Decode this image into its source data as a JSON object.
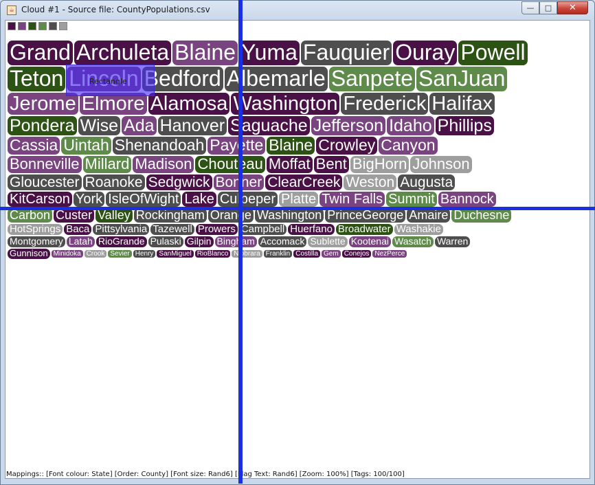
{
  "window": {
    "title": "Cloud #1 - Source file: CountyPopulations.csv",
    "app_icon": "java-cup-icon",
    "controls": {
      "minimize": "—",
      "maximize": "□",
      "close": "✕"
    }
  },
  "palette": [
    "#4a1147",
    "#7a4480",
    "#2d5314",
    "#5e8a4a",
    "#4e4e4e",
    "#9e9e9e"
  ],
  "selection": {
    "label": "Rectangle"
  },
  "cloud": {
    "rows": [
      {
        "size": 32,
        "tags": [
          {
            "text": "Grand",
            "color": "#4a1147"
          },
          {
            "text": "Archuleta",
            "color": "#4a1147"
          },
          {
            "text": "Blaine",
            "color": "#7a4480"
          },
          {
            "text": "Yuma",
            "color": "#4a1147"
          },
          {
            "text": "Fauquier",
            "color": "#4e4e4e"
          },
          {
            "text": "Ouray",
            "color": "#4a1147"
          },
          {
            "text": "Powell",
            "color": "#2d5314"
          }
        ]
      },
      {
        "size": 32,
        "tags": [
          {
            "text": "Teton",
            "color": "#2d5314"
          },
          {
            "text": "Lincoln",
            "color": "#7a4480"
          },
          {
            "text": "Bedford",
            "color": "#4e4e4e"
          },
          {
            "text": "Albemarle",
            "color": "#4e4e4e"
          },
          {
            "text": "Sanpete",
            "color": "#5e8a4a"
          },
          {
            "text": "SanJuan",
            "color": "#5e8a4a"
          }
        ]
      },
      {
        "size": 29,
        "tags": [
          {
            "text": "Jerome",
            "color": "#7a4480"
          },
          {
            "text": "Elmore",
            "color": "#7a4480"
          },
          {
            "text": "Alamosa",
            "color": "#4a1147"
          },
          {
            "text": "Washington",
            "color": "#4a1147"
          },
          {
            "text": "Frederick",
            "color": "#4e4e4e"
          },
          {
            "text": "Halifax",
            "color": "#4e4e4e"
          }
        ]
      },
      {
        "size": 25,
        "tags": [
          {
            "text": "Pondera",
            "color": "#2d5314"
          },
          {
            "text": "Wise",
            "color": "#4e4e4e"
          },
          {
            "text": "Ada",
            "color": "#7a4480"
          },
          {
            "text": "Hanover",
            "color": "#4e4e4e"
          },
          {
            "text": "Saguache",
            "color": "#4a1147"
          },
          {
            "text": "Jefferson",
            "color": "#7a4480"
          },
          {
            "text": "Idaho",
            "color": "#7a4480"
          },
          {
            "text": "Phillips",
            "color": "#4a1147"
          }
        ]
      },
      {
        "size": 23,
        "tags": [
          {
            "text": "Cassia",
            "color": "#7a4480"
          },
          {
            "text": "Uintah",
            "color": "#5e8a4a"
          },
          {
            "text": "Shenandoah",
            "color": "#4e4e4e"
          },
          {
            "text": "Payette",
            "color": "#7a4480"
          },
          {
            "text": "Blaine",
            "color": "#2d5314"
          },
          {
            "text": "Crowley",
            "color": "#4a1147"
          },
          {
            "text": "Canyon",
            "color": "#7a4480"
          }
        ]
      },
      {
        "size": 22,
        "tags": [
          {
            "text": "Bonneville",
            "color": "#7a4480"
          },
          {
            "text": "Millard",
            "color": "#5e8a4a"
          },
          {
            "text": "Madison",
            "color": "#7a4480"
          },
          {
            "text": "Chouteau",
            "color": "#2d5314"
          },
          {
            "text": "Moffat",
            "color": "#4a1147"
          },
          {
            "text": "Bent",
            "color": "#4a1147"
          },
          {
            "text": "BigHorn",
            "color": "#9e9e9e"
          },
          {
            "text": "Johnson",
            "color": "#9e9e9e"
          }
        ]
      },
      {
        "size": 21,
        "tags": [
          {
            "text": "Gloucester",
            "color": "#4e4e4e"
          },
          {
            "text": "Roanoke",
            "color": "#4e4e4e"
          },
          {
            "text": "Sedgwick",
            "color": "#4a1147"
          },
          {
            "text": "Bonner",
            "color": "#7a4480"
          },
          {
            "text": "ClearCreek",
            "color": "#4a1147"
          },
          {
            "text": "Weston",
            "color": "#9e9e9e"
          },
          {
            "text": "Augusta",
            "color": "#4e4e4e"
          }
        ]
      },
      {
        "size": 20,
        "tags": [
          {
            "text": "KitCarson",
            "color": "#4a1147"
          },
          {
            "text": "York",
            "color": "#4e4e4e"
          },
          {
            "text": "IsleOfWight",
            "color": "#4e4e4e"
          },
          {
            "text": "Lake",
            "color": "#4a1147"
          },
          {
            "text": "Culpeper",
            "color": "#4e4e4e"
          },
          {
            "text": "Platte",
            "color": "#9e9e9e"
          },
          {
            "text": "Twin Falls",
            "color": "#7a4480"
          },
          {
            "text": "Summit",
            "color": "#5e8a4a"
          },
          {
            "text": "Bannock",
            "color": "#7a4480"
          }
        ]
      },
      {
        "size": 18,
        "tags": [
          {
            "text": "Carbon",
            "color": "#5e8a4a"
          },
          {
            "text": "Custer",
            "color": "#4a1147"
          },
          {
            "text": "Valley",
            "color": "#2d5314"
          },
          {
            "text": "Rockingham",
            "color": "#4e4e4e"
          },
          {
            "text": "Orange",
            "color": "#4e4e4e"
          },
          {
            "text": "Washington",
            "color": "#4e4e4e"
          },
          {
            "text": "PrinceGeorge",
            "color": "#4e4e4e"
          },
          {
            "text": "Amaire",
            "color": "#4e4e4e"
          },
          {
            "text": "Duchesne",
            "color": "#5e8a4a"
          }
        ]
      },
      {
        "size": 15,
        "tags": [
          {
            "text": "HotSprings",
            "color": "#9e9e9e"
          },
          {
            "text": "Baca",
            "color": "#4a1147"
          },
          {
            "text": "Pittsylvania",
            "color": "#4e4e4e"
          },
          {
            "text": "Tazewell",
            "color": "#4e4e4e"
          },
          {
            "text": "Prowers",
            "color": "#4a1147"
          },
          {
            "text": "Campbell",
            "color": "#4e4e4e"
          },
          {
            "text": "Huerfano",
            "color": "#4a1147"
          },
          {
            "text": "Broadwater",
            "color": "#2d5314"
          },
          {
            "text": "Washakie",
            "color": "#9e9e9e"
          }
        ]
      },
      {
        "size": 14,
        "tags": [
          {
            "text": "Montgomery",
            "color": "#4e4e4e"
          },
          {
            "text": "Latah",
            "color": "#7a4480"
          },
          {
            "text": "RioGrande",
            "color": "#4a1147"
          },
          {
            "text": "Pulaski",
            "color": "#4e4e4e"
          },
          {
            "text": "Gilpin",
            "color": "#4a1147"
          },
          {
            "text": "Bingham",
            "color": "#7a4480"
          },
          {
            "text": "Accomack",
            "color": "#4e4e4e"
          },
          {
            "text": "Sublette",
            "color": "#9e9e9e"
          },
          {
            "text": "Kootenai",
            "color": "#7a4480"
          },
          {
            "text": "Wasatch",
            "color": "#5e8a4a"
          },
          {
            "text": "Warren",
            "color": "#4e4e4e"
          }
        ]
      },
      {
        "size": 13,
        "tags": [
          {
            "text": "Gunnison",
            "color": "#4a1147"
          }
        ]
      }
    ],
    "tiny_row": {
      "size": 10,
      "tags": [
        {
          "text": "Minidoka",
          "color": "#7a4480"
        },
        {
          "text": "Crook",
          "color": "#9e9e9e"
        },
        {
          "text": "Sevier",
          "color": "#5e8a4a"
        },
        {
          "text": "Henry",
          "color": "#4e4e4e"
        },
        {
          "text": "SanMiguel",
          "color": "#4a1147"
        },
        {
          "text": "RioBlanco",
          "color": "#4a1147"
        },
        {
          "text": "Niobrara",
          "color": "#9e9e9e"
        },
        {
          "text": "Franklin",
          "color": "#4e4e4e"
        },
        {
          "text": "Costilla",
          "color": "#4a1147"
        },
        {
          "text": "Gem",
          "color": "#7a4480"
        },
        {
          "text": "Conejos",
          "color": "#4a1147"
        },
        {
          "text": "NezPerce",
          "color": "#7a4480"
        }
      ]
    }
  },
  "status": {
    "text": "Mappings:: [Font colour: State]  [Order: County]  [Font size: Rand6]  [Flag Text: Rand6]  [Zoom: 100%]  [Tags: 100/100]"
  }
}
